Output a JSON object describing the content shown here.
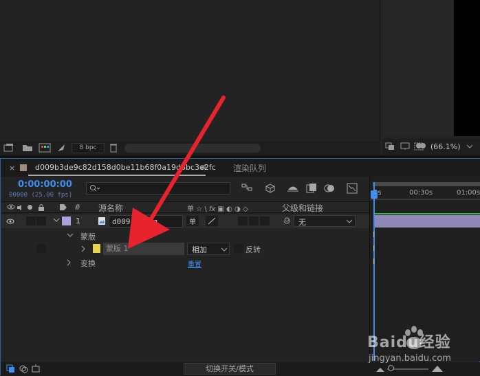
{
  "project": {
    "bpc": "8 bpc"
  },
  "viewer": {
    "zoom": "(66.1%)"
  },
  "timeline": {
    "comp_tab": "d009b3de9c82d158d0be11b68f0a19d8bc3e2fc",
    "tab_menu": "≡",
    "render_queue_tab": "渲染队列",
    "timecode": "0:00:00:00",
    "frame_info": "00000 (25.00 fps)",
    "search_placeholder": "",
    "columns": {
      "hash": "#",
      "source_name": "源名称",
      "switches": "单 ☆ \\ fx",
      "parent": "父级和链接"
    },
    "layer": {
      "index": "1",
      "name": "d009b3de9…..jpg",
      "name_display": "d009...jpg",
      "switch": "单",
      "parent_value": "无"
    },
    "masks_label": "蒙版",
    "mask": {
      "name": "蒙版 1",
      "mode": "相加",
      "invert_label": "反转"
    },
    "transform_label": "变换",
    "reset_label": "重置",
    "ruler": [
      "0s",
      "00:30s",
      "01:00s"
    ],
    "footer_toggle": "切换开关/模式"
  },
  "watermark": {
    "brand": "Baidu经验",
    "url": "jingyan.baidu.com"
  },
  "colors": {
    "accent": "#3f8ef0",
    "arrow": "#e8232d",
    "layer_label": "#a9a2d8",
    "mask_label": "#e8d44d"
  }
}
